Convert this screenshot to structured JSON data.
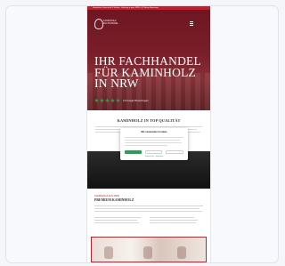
{
  "topbar": {
    "text": "Kostenloser Versand ab 5 Säcken • Lieferung in ganz NRW • 4,9 Sterne Bewertung"
  },
  "logo": {
    "line1": "KAMINHOLZ",
    "line2": "FACHHANDEL"
  },
  "hero": {
    "headline": "IHR FACHHANDEL\nFÜR KAMINHOLZ\nIN NRW",
    "rating_text": "4,9 Google Bewertungen",
    "stars": 5
  },
  "section2": {
    "heading": "KAMINHOLZ IN TOP QUALITÄT"
  },
  "cookie": {
    "title": "Wir verwenden Cookies",
    "accept": "Akzeptieren",
    "deny": "Ablehnen",
    "settings": "Einstellungen",
    "link": "Datenschutz · Impressum"
  },
  "section3": {
    "label": "KAMINHOLZ AUS NRW",
    "title": "PREMIUM KAMINHOLZ"
  },
  "colors": {
    "accent": "#c81e2b",
    "hero_bg": "#7a1f2a",
    "rating_green": "#2ea84f",
    "accept_green": "#2e9e55"
  }
}
